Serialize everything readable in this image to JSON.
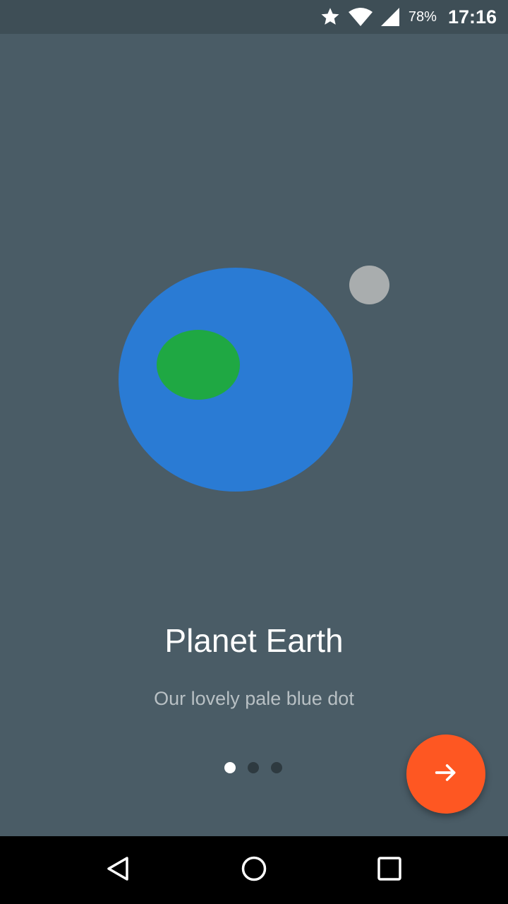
{
  "status_bar": {
    "battery": "78%",
    "time": "17:16",
    "icons": [
      "star-icon",
      "wifi-icon",
      "signal-icon"
    ]
  },
  "slide": {
    "title": "Planet Earth",
    "description": "Our lovely pale blue dot"
  },
  "pager": {
    "total": 3,
    "active_index": 0
  },
  "fab": {
    "icon": "arrow-right-icon"
  },
  "nav_bar": {
    "buttons": [
      "back-icon",
      "home-icon",
      "recents-icon"
    ]
  },
  "colors": {
    "background": "#4a5c66",
    "status_bar": "#3e4e56",
    "planet": "#2a7bd4",
    "continent": "#1fa843",
    "moon": "#a9adae",
    "fab": "#fe5722"
  }
}
